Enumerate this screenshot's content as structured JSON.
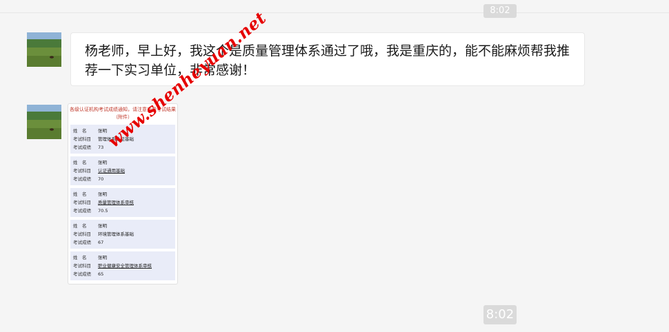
{
  "top_timestamp": "8:02",
  "messages": [
    {
      "type": "text",
      "text": "杨老师，早上好，我这个是质量管理体系通过了哦，我是重庆的，能不能麻烦帮我推荐一下实习单位，非常感谢！"
    },
    {
      "type": "image",
      "image": {
        "header": "各级认证机构考试成绩通知，请注意查看考试结果（附件）",
        "records": [
          {
            "name_label": "姓　名",
            "name": "张明",
            "subject_label": "考试科目",
            "subject": "管理体系认证基础",
            "score_label": "考试成绩",
            "score": "73"
          },
          {
            "name_label": "姓　名",
            "name": "张明",
            "subject_label": "考试科目",
            "subject": "认证通用基础",
            "score_label": "考试成绩",
            "score": "70"
          },
          {
            "name_label": "姓　名",
            "name": "张明",
            "subject_label": "考试科目",
            "subject": "质量管理体系审核",
            "score_label": "考试成绩",
            "score": "70.5"
          },
          {
            "name_label": "姓　名",
            "name": "张明",
            "subject_label": "考试科目",
            "subject": "环境管理体系基础",
            "score_label": "考试成绩",
            "score": "67"
          },
          {
            "name_label": "姓　名",
            "name": "张明",
            "subject_label": "考试科目",
            "subject": "职业健康安全管理体系审核",
            "score_label": "考试成绩",
            "score": "65"
          }
        ]
      }
    }
  ],
  "watermark": "www.shenheyuan.net",
  "bottom_timestamp": "8:02",
  "colors": {
    "background": "#f5f5f5",
    "bubble": "#ffffff",
    "watermark": "#e60000",
    "timestamp_badge": "#dadada"
  }
}
